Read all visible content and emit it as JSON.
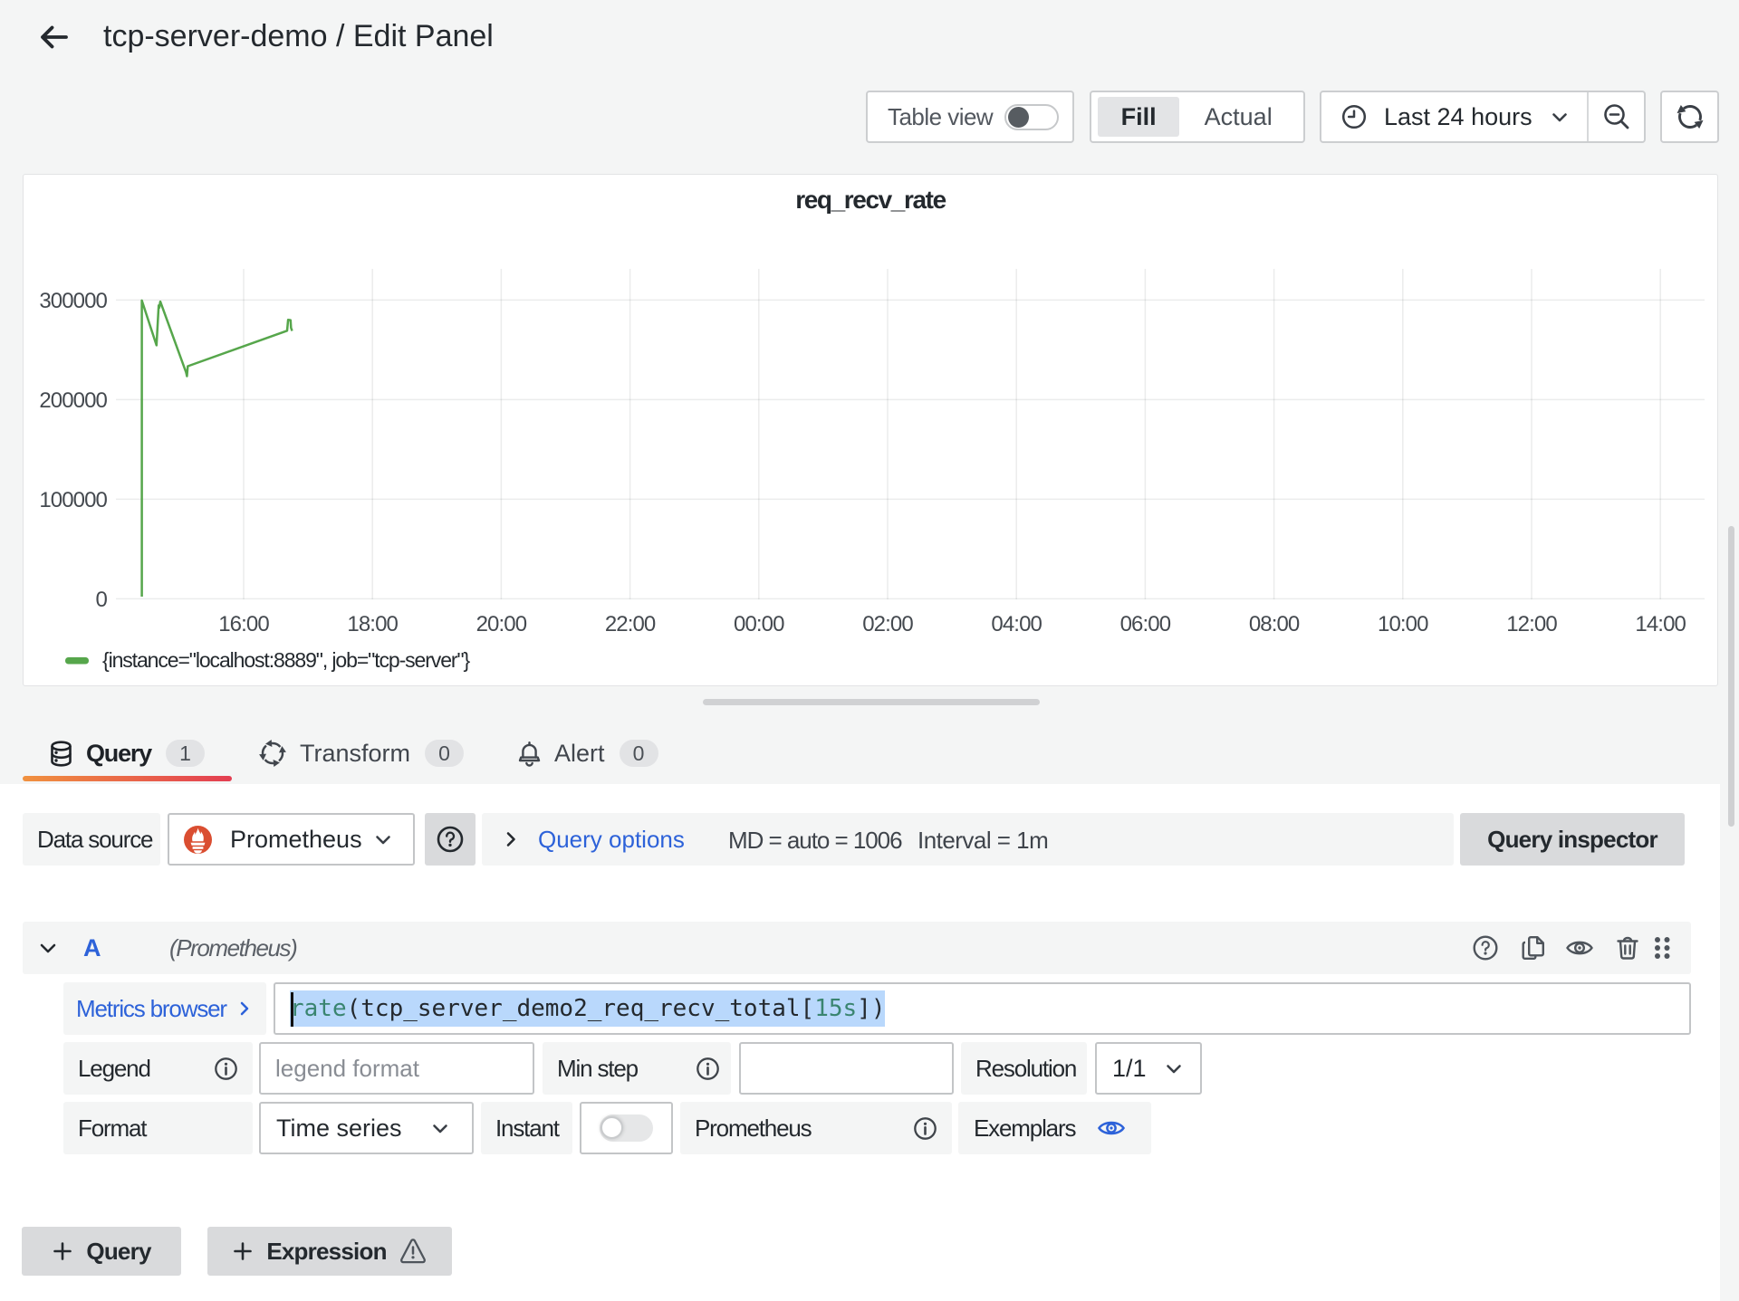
{
  "header": {
    "title": "tcp-server-demo / Edit Panel"
  },
  "toolbar": {
    "table_view_label": "Table view",
    "fill_label": "Fill",
    "actual_label": "Actual",
    "time_range_label": "Last 24 hours"
  },
  "chart_data": {
    "type": "line",
    "title": "req_recv_rate",
    "x_ticks": [
      "16:00",
      "18:00",
      "20:00",
      "22:00",
      "00:00",
      "02:00",
      "04:00",
      "06:00",
      "08:00",
      "10:00",
      "12:00",
      "14:00"
    ],
    "y_ticks": [
      0,
      100000,
      200000,
      300000
    ],
    "ylim": [
      0,
      330000
    ],
    "grid": true,
    "legend_position": "bottom-left",
    "series": [
      {
        "name": "{instance=\"localhost:8889\", job=\"tcp-server\"}",
        "color": "#56A64B",
        "points_t_hours_from_1600": [
          -1.581,
          -1.581,
          -1.353,
          -1.319,
          -1.311,
          -1.294,
          -0.893,
          -0.88,
          -0.868,
          0.675,
          0.691,
          0.728,
          0.736,
          0.752
        ],
        "points_value": [
          2200,
          299500,
          254500,
          294500,
          292200,
          298500,
          227200,
          223500,
          233500,
          269200,
          280100,
          279800,
          272200,
          269000
        ]
      }
    ]
  },
  "tabs": [
    {
      "label": "Query",
      "count": "1"
    },
    {
      "label": "Transform",
      "count": "0"
    },
    {
      "label": "Alert",
      "count": "0"
    }
  ],
  "query_editor": {
    "datasource_label": "Data source",
    "datasource_value": "Prometheus",
    "query_options_label": "Query options",
    "query_options_md": "MD = auto = 1006",
    "query_options_interval": "Interval = 1m",
    "query_inspector_label": "Query inspector",
    "ref_id": "A",
    "datasource_hint": "(Prometheus)",
    "metrics_browser_label": "Metrics browser",
    "query_tokens": [
      {
        "text": "rate",
        "type": "func"
      },
      {
        "text": "(",
        "type": "punct"
      },
      {
        "text": "tcp_server_demo2_req_recv_total",
        "type": "metric"
      },
      {
        "text": "[",
        "type": "punct"
      },
      {
        "text": "15s",
        "type": "duration"
      },
      {
        "text": "]",
        "type": "punct"
      },
      {
        "text": ")",
        "type": "punct"
      }
    ],
    "legend_label": "Legend",
    "legend_placeholder": "legend format",
    "min_step_label": "Min step",
    "min_step_value": "",
    "resolution_label": "Resolution",
    "resolution_value": "1/1",
    "format_label": "Format",
    "format_value": "Time series",
    "instant_label": "Instant",
    "prometheus_label": "Prometheus",
    "exemplars_label": "Exemplars",
    "add_query_label": "Query",
    "add_expression_label": "Expression"
  },
  "colors": {
    "accent_blue": "#2d62d9",
    "series_green": "#56A64B",
    "tab_gradient_left": "#f0913f",
    "tab_gradient_right": "#e33e52",
    "prometheus_orange": "#da4e31",
    "selection_blue": "#b9d8fc",
    "token_green": "#3a8570"
  }
}
